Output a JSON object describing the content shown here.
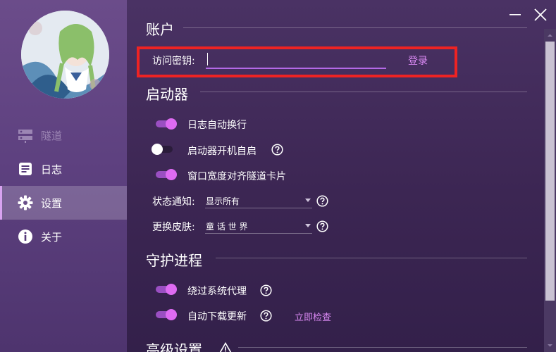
{
  "sidebar": {
    "items": [
      {
        "label": "隧道",
        "icon": "server-icon",
        "state": "disabled"
      },
      {
        "label": "日志",
        "icon": "log-icon",
        "state": "normal"
      },
      {
        "label": "设置",
        "icon": "gear-icon",
        "state": "active"
      },
      {
        "label": "关于",
        "icon": "info-icon",
        "state": "normal"
      }
    ]
  },
  "window": {
    "minimize_icon": "minimize-icon",
    "close_icon": "close-icon"
  },
  "account": {
    "title": "账户",
    "key_label": "访问密钥:",
    "key_value": "",
    "login_label": "登录"
  },
  "launcher": {
    "title": "启动器",
    "options": [
      {
        "label": "日志自动换行",
        "enabled": true,
        "help": false
      },
      {
        "label": "启动器开机自启",
        "enabled": false,
        "help": true
      },
      {
        "label": "窗口宽度对齐隧道卡片",
        "enabled": true,
        "help": false
      }
    ],
    "status_notify": {
      "label": "状态通知:",
      "value": "显示所有"
    },
    "skin": {
      "label": "更换皮肤:",
      "value": "童 话 世 界"
    }
  },
  "daemon": {
    "title": "守护进程",
    "options": [
      {
        "label": "绕过系统代理",
        "enabled": true,
        "help": true
      },
      {
        "label": "自动下载更新",
        "enabled": true,
        "help": true
      }
    ],
    "check_now_label": "立即检查"
  },
  "advanced": {
    "title": "高级设置",
    "icon": "warning-icon"
  },
  "colors": {
    "accent": "#de6bf2",
    "link": "#d989f2",
    "highlight_border": "#ee2323",
    "sidebar_bg": "#5e4180",
    "content_bg": "#3c2653"
  }
}
